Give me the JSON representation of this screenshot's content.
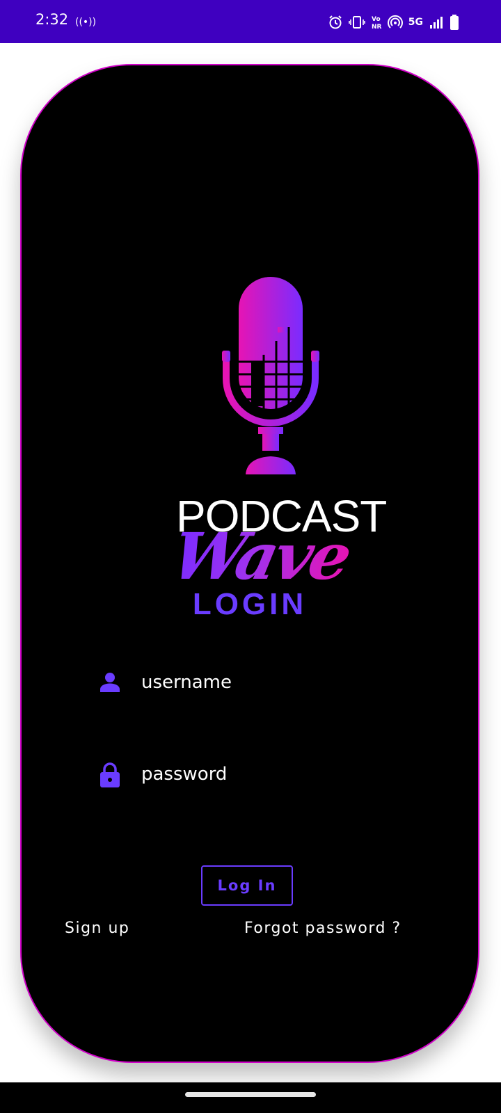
{
  "status_bar": {
    "time": "2:32",
    "hotspot_glyph": "((•))",
    "network": "5G",
    "icons": [
      "alarm-icon",
      "vibrate-icon",
      "vonr-icon",
      "hotspot-icon",
      "signal-icon",
      "battery-icon"
    ],
    "background_color": "#3f00c0"
  },
  "logo": {
    "line1": "PODCAST",
    "line2": "Wave",
    "icon": "microphone-icon",
    "gradient_colors": [
      "#e614b4",
      "#7a2cff"
    ]
  },
  "login": {
    "title": "LOGIN",
    "username_placeholder": "username",
    "password_placeholder": "password",
    "username_icon": "person-icon",
    "password_icon": "lock-icon",
    "login_button": "Log In",
    "signup_link": "Sign up",
    "forgot_link": "Forgot password ?",
    "accent_color": "#6a3cff",
    "border_color": "#d000c8"
  }
}
